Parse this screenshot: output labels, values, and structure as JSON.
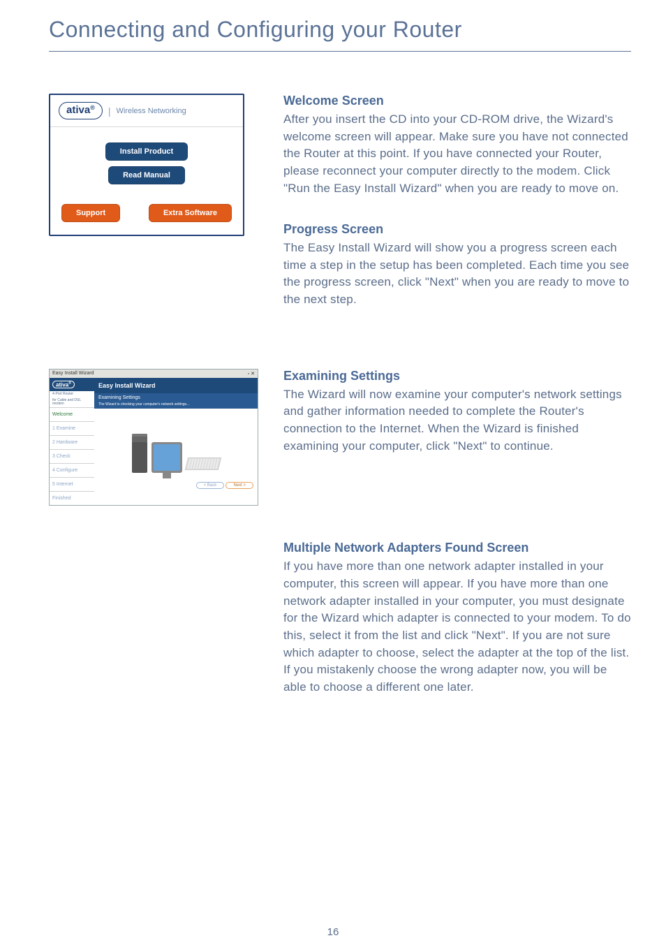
{
  "page": {
    "title": "Connecting and Configuring your Router",
    "number": "16"
  },
  "installer": {
    "brand": "ativa",
    "subtitle": "Wireless Networking",
    "install_label": "Install Product",
    "manual_label": "Read Manual",
    "support_label": "Support",
    "extra_label": "Extra Software"
  },
  "sections": {
    "welcome": {
      "heading": "Welcome Screen",
      "body": "After you insert the CD into your CD-ROM drive, the Wizard's welcome screen will appear. Make sure you have not connected the Router at this point. If you have connected your Router, please reconnect your computer directly to the modem. Click \"Run the Easy Install Wizard\" when you are ready to move on."
    },
    "progress": {
      "heading": "Progress Screen",
      "body": "The Easy Install Wizard will show you a progress screen each time a step in the setup has been completed. Each time you see the progress screen, click \"Next\" when you are ready to move to the next step."
    },
    "examining": {
      "heading": "Examining Settings",
      "body": "The Wizard will now examine your computer's network settings and gather information needed to complete the Router's connection to the Internet. When the Wizard is finished examining your computer, click \"Next\" to continue."
    },
    "adapters": {
      "heading": "Multiple Network Adapters Found Screen",
      "body": "If you have more than one network adapter installed in your computer, this screen will appear. If you have more than one network adapter installed in your computer, you must designate for the Wizard which adapter is connected to your modem. To do this, select it from the list and click \"Next\". If you are not sure which adapter to choose, select the adapter at the top of the list. If you mistakenly choose the wrong adapter now, you will be able to choose a different one later."
    }
  },
  "wizard": {
    "window_title": "Easy Install Wizard",
    "brand": "ativa",
    "product1": "4-Port Router",
    "product2": "for Cable and DSL modem",
    "header": "Easy Install Wizard",
    "subheader": "Examining Settings",
    "desc": "The Wizard is checking your computer's network settings...",
    "steps": {
      "welcome": "Welcome",
      "examine": "1 Examine",
      "hardware": "2 Hardware",
      "check": "3 Check",
      "configure": "4 Configure",
      "internet": "5 Internet",
      "finished": "Finished"
    },
    "back_label": "< Back",
    "next_label": "Next >"
  }
}
